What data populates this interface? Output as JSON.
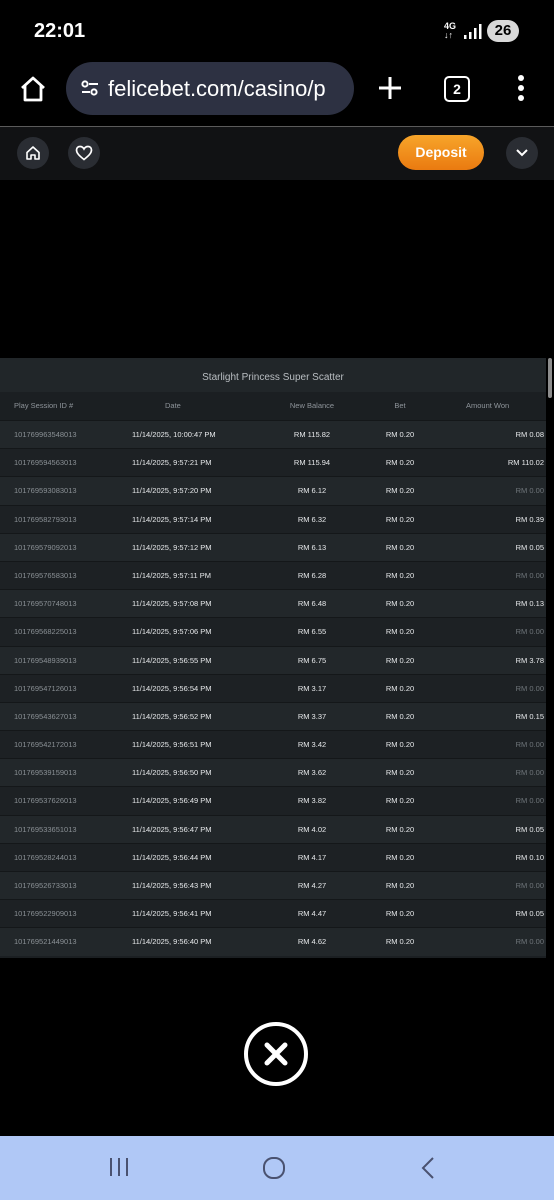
{
  "status_bar": {
    "time": "22:01",
    "network": "4G",
    "battery": "26"
  },
  "browser": {
    "url": "felicebet.com/casino/p",
    "tab_count": "2"
  },
  "site_header": {
    "deposit_label": "Deposit"
  },
  "history": {
    "title": "Starlight Princess Super Scatter",
    "columns": [
      "Play Session ID #",
      "Date",
      "New Balance",
      "Bet",
      "Amount Won"
    ],
    "rows": [
      {
        "id": "101769963548013",
        "date": "11/14/2025, 10:00:47 PM",
        "balance": "RM 115.82",
        "bet": "RM 0.20",
        "won": "RM 0.08"
      },
      {
        "id": "101769594563013",
        "date": "11/14/2025, 9:57:21 PM",
        "balance": "RM 115.94",
        "bet": "RM 0.20",
        "won": "RM 110.02"
      },
      {
        "id": "101769593083013",
        "date": "11/14/2025, 9:57:20 PM",
        "balance": "RM 6.12",
        "bet": "RM 0.20",
        "won": "RM 0.00"
      },
      {
        "id": "101769582793013",
        "date": "11/14/2025, 9:57:14 PM",
        "balance": "RM 6.32",
        "bet": "RM 0.20",
        "won": "RM 0.39"
      },
      {
        "id": "101769579092013",
        "date": "11/14/2025, 9:57:12 PM",
        "balance": "RM 6.13",
        "bet": "RM 0.20",
        "won": "RM 0.05"
      },
      {
        "id": "101769576583013",
        "date": "11/14/2025, 9:57:11 PM",
        "balance": "RM 6.28",
        "bet": "RM 0.20",
        "won": "RM 0.00"
      },
      {
        "id": "101769570748013",
        "date": "11/14/2025, 9:57:08 PM",
        "balance": "RM 6.48",
        "bet": "RM 0.20",
        "won": "RM 0.13"
      },
      {
        "id": "101769568225013",
        "date": "11/14/2025, 9:57:06 PM",
        "balance": "RM 6.55",
        "bet": "RM 0.20",
        "won": "RM 0.00"
      },
      {
        "id": "101769548939013",
        "date": "11/14/2025, 9:56:55 PM",
        "balance": "RM 6.75",
        "bet": "RM 0.20",
        "won": "RM 3.78"
      },
      {
        "id": "101769547126013",
        "date": "11/14/2025, 9:56:54 PM",
        "balance": "RM 3.17",
        "bet": "RM 0.20",
        "won": "RM 0.00"
      },
      {
        "id": "101769543627013",
        "date": "11/14/2025, 9:56:52 PM",
        "balance": "RM 3.37",
        "bet": "RM 0.20",
        "won": "RM 0.15"
      },
      {
        "id": "101769542172013",
        "date": "11/14/2025, 9:56:51 PM",
        "balance": "RM 3.42",
        "bet": "RM 0.20",
        "won": "RM 0.00"
      },
      {
        "id": "101769539159013",
        "date": "11/14/2025, 9:56:50 PM",
        "balance": "RM 3.62",
        "bet": "RM 0.20",
        "won": "RM 0.00"
      },
      {
        "id": "101769537626013",
        "date": "11/14/2025, 9:56:49 PM",
        "balance": "RM 3.82",
        "bet": "RM 0.20",
        "won": "RM 0.00"
      },
      {
        "id": "101769533651013",
        "date": "11/14/2025, 9:56:47 PM",
        "balance": "RM 4.02",
        "bet": "RM 0.20",
        "won": "RM 0.05"
      },
      {
        "id": "101769528244013",
        "date": "11/14/2025, 9:56:44 PM",
        "balance": "RM 4.17",
        "bet": "RM 0.20",
        "won": "RM 0.10"
      },
      {
        "id": "101769526733013",
        "date": "11/14/2025, 9:56:43 PM",
        "balance": "RM 4.27",
        "bet": "RM 0.20",
        "won": "RM 0.00"
      },
      {
        "id": "101769522909013",
        "date": "11/14/2025, 9:56:41 PM",
        "balance": "RM 4.47",
        "bet": "RM 0.20",
        "won": "RM 0.05"
      },
      {
        "id": "101769521449013",
        "date": "11/14/2025, 9:56:40 PM",
        "balance": "RM 4.62",
        "bet": "RM 0.20",
        "won": "RM 0.00"
      }
    ]
  },
  "colors": {
    "accent_orange": "#f39323",
    "nav_bar": "#b0c8f6",
    "url_pill": "#2d3142"
  },
  "icons": [
    "home-icon",
    "tune-icon",
    "plus-icon",
    "tabs-icon",
    "more-vert-icon",
    "heart-icon",
    "chevron-down-icon",
    "close-icon",
    "recents-icon",
    "nav-home-icon",
    "back-icon"
  ]
}
